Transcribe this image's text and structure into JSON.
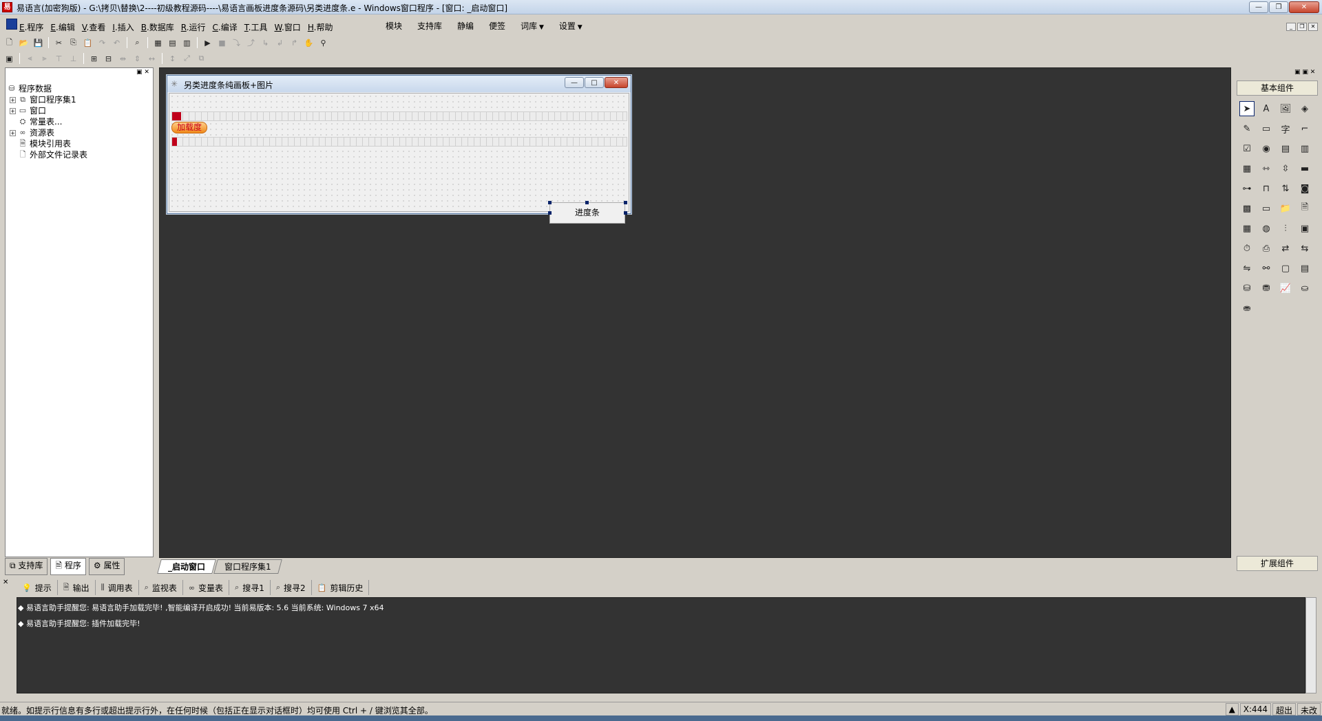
{
  "window": {
    "title": "易语言(加密狗版) - G:\\拷贝\\替换\\2----初级教程源码----\\易语言画板进度条源码\\另类进度条.e - Windows窗口程序 - [窗口: _启动窗口]"
  },
  "menu": {
    "left": [
      {
        "key": "E",
        "label": ".程序"
      },
      {
        "key": "E",
        "label": ".编辑"
      },
      {
        "key": "V",
        "label": ".查看"
      },
      {
        "key": "I",
        "label": ".插入"
      },
      {
        "key": "B",
        "label": ".数据库"
      },
      {
        "key": "R",
        "label": ".运行"
      },
      {
        "key": "C",
        "label": ".编译"
      },
      {
        "key": "T",
        "label": ".工具"
      },
      {
        "key": "W",
        "label": ".窗口"
      },
      {
        "key": "H",
        "label": ".帮助"
      }
    ],
    "right": [
      "模块",
      "支持库",
      "静编",
      "便签",
      "词库",
      "设置"
    ]
  },
  "tree": {
    "root": "程序数据",
    "items": [
      "窗口程序集1",
      "窗口",
      "常量表...",
      "资源表",
      "模块引用表",
      "外部文件记录表"
    ]
  },
  "left_tabs": [
    "支持库",
    "程序",
    "属性"
  ],
  "doc_tabs": [
    "_启动窗口",
    "窗口程序集1"
  ],
  "form": {
    "title": "另类进度条纯画板+图片",
    "label_text": "加载度",
    "button_text": "进度条",
    "progress_1": 0.02,
    "progress_2": 0.01
  },
  "right_panel": {
    "basic": "基本组件",
    "extended": "扩展组件"
  },
  "output_tabs": [
    "提示",
    "输出",
    "调用表",
    "监视表",
    "变量表",
    "搜寻1",
    "搜寻2",
    "剪辑历史"
  ],
  "output_lines": [
    "易语言助手提醒您: 易语言助手加载完毕! ,智能编译开启成功! 当前易版本: 5.6 当前系统: Windows 7 x64",
    "易语言助手提醒您: 插件加载完毕!"
  ],
  "status": {
    "text": "就绪。如提示行信息有多行或超出提示行外，在任何时候（包括正在显示对话框时）均可使用 Ctrl + / 键浏览其全部。",
    "coord": "X:444",
    "overwrite": "超出",
    "save": "未改"
  }
}
